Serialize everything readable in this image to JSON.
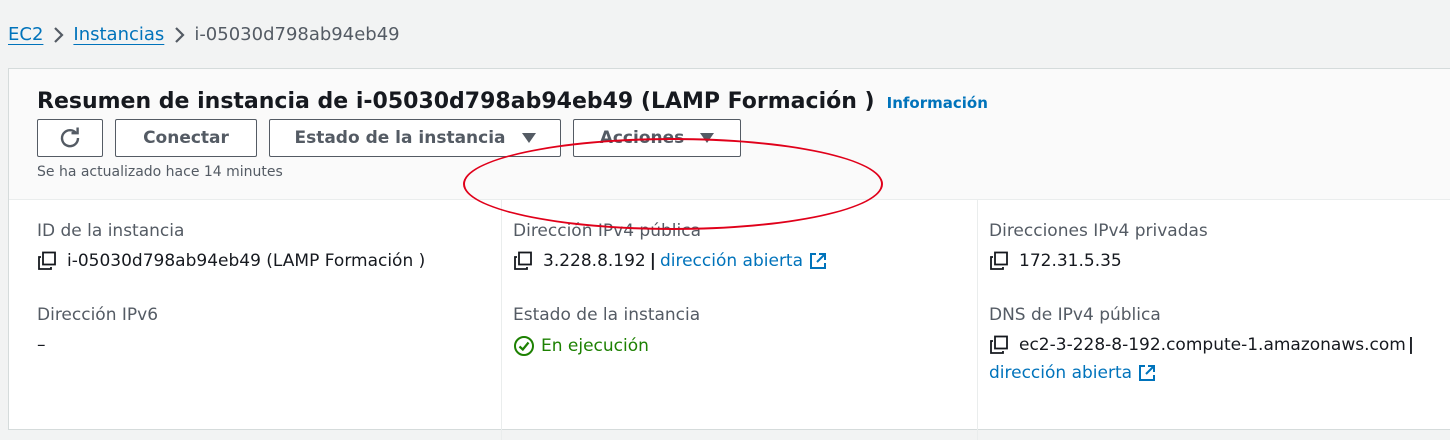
{
  "breadcrumb": {
    "items": [
      {
        "label": "EC2"
      },
      {
        "label": "Instancias"
      }
    ],
    "current": "i-05030d798ab94eb49"
  },
  "header": {
    "title": "Resumen de instancia de i-05030d798ab94eb49 (LAMP Formación )",
    "info_link": "Información",
    "buttons": {
      "refresh_icon": "refresh-icon",
      "connect": "Conectar",
      "instance_state": "Estado de la instancia",
      "actions": "Acciones"
    },
    "updated_text": "Se ha actualizado hace 14 minutes"
  },
  "details": {
    "instance_id": {
      "label": "ID de la instancia",
      "value": "i-05030d798ab94eb49 (LAMP Formación )"
    },
    "public_ipv4": {
      "label": "Dirección IPv4 pública",
      "value": "3.228.8.192",
      "separator": "|",
      "link": "dirección abierta"
    },
    "private_ipv4": {
      "label": "Direcciones IPv4 privadas",
      "value": "172.31.5.35"
    },
    "ipv6": {
      "label": "Dirección IPv6",
      "value": "–"
    },
    "instance_state": {
      "label": "Estado de la instancia",
      "value": "En ejecución"
    },
    "public_dns": {
      "label": "DNS de IPv4 pública",
      "value": "ec2-3-228-8-192.compute-1.amazonaws.com",
      "separator": "|",
      "link": "dirección abierta"
    }
  },
  "colors": {
    "link": "#0073bb",
    "status_running": "#1d8102",
    "highlight": "#e0001a"
  }
}
